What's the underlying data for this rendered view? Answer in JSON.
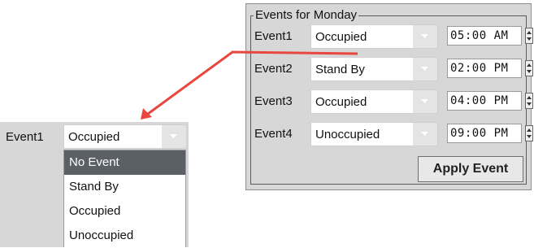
{
  "panel": {
    "legend": "Events for Monday",
    "events": [
      {
        "label": "Event1",
        "value": "Occupied",
        "time": "05:00 AM"
      },
      {
        "label": "Event2",
        "value": "Stand By",
        "time": "02:00 PM"
      },
      {
        "label": "Event3",
        "value": "Occupied",
        "time": "04:00 PM"
      },
      {
        "label": "Event4",
        "value": "Unoccupied",
        "time": "09:00 PM"
      }
    ],
    "apply_label": "Apply Event"
  },
  "dropdown": {
    "label": "Event1",
    "value": "Occupied",
    "options": [
      "No Event",
      "Stand By",
      "Occupied",
      "Unoccupied"
    ],
    "selected_option": "No Event"
  },
  "colors": {
    "panel_bg": "#d7d7d7",
    "arrow": "#e8473f",
    "selected_bg": "#5b5f66"
  },
  "icons": {
    "combo_arrow": "chevron-down-icon",
    "spinner": "spinner-updown-icon",
    "callout": "arrow-callout-icon"
  }
}
